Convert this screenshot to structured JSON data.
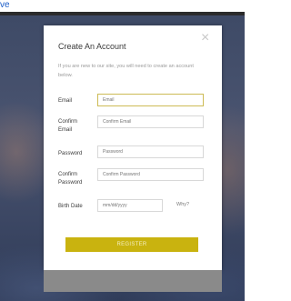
{
  "topbar": {
    "link_text": "ve"
  },
  "modal": {
    "close_symbol": "×",
    "title": "Create An Account",
    "intro": "If you are new to our site, you will need to create an account below.",
    "fields": {
      "email": {
        "label": "Email",
        "placeholder": "Email"
      },
      "confirm_email": {
        "label": "Confirm\nEmail",
        "placeholder": "Confirm Email"
      },
      "password": {
        "label": "Password",
        "placeholder": "Password"
      },
      "confirm_password": {
        "label": "Confirm\nPassword",
        "placeholder": "Confirm Password"
      },
      "birth_date": {
        "label": "Birth Date",
        "placeholder": "mm/dd/yyyy",
        "help_link": "Why?"
      }
    },
    "register_label": "REGISTER"
  },
  "colors": {
    "accent": "#c9b30f",
    "link": "#1a5cc8"
  }
}
